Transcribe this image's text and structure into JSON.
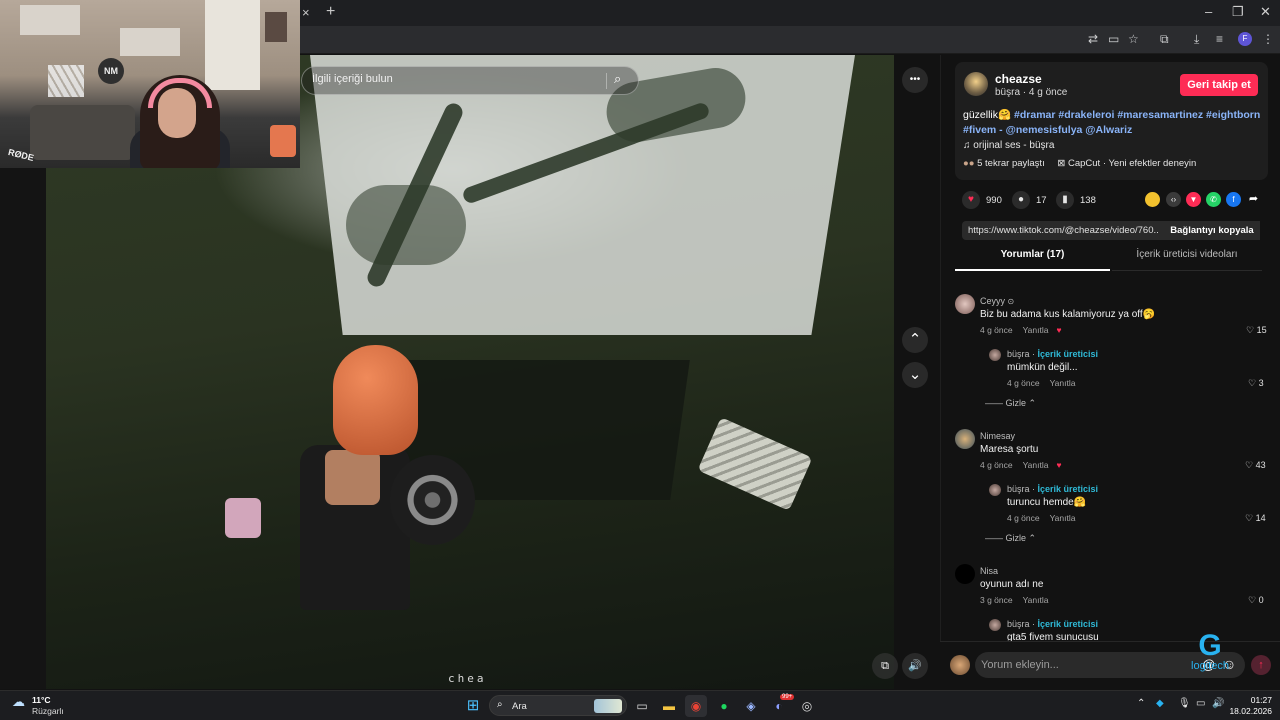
{
  "browser": {
    "tab_close_glyph": "×",
    "new_tab_glyph": "+",
    "window_controls": [
      "–",
      "❐",
      "✕"
    ],
    "toolbar_icons": [
      "translate-icon",
      "cast-icon",
      "star-icon",
      "extensions-icon",
      "download-icon",
      "media-icon"
    ],
    "profile_initial": "F",
    "menu_glyph": "⋮"
  },
  "video": {
    "search_placeholder": "İlgili içeriği bulun",
    "more_glyph": "•••",
    "up_glyph": "⌃",
    "down_glyph": "⌄",
    "watermark": "chea",
    "mute_glyph": "🔊",
    "pip_glyph": "⧉"
  },
  "webcam": {
    "logo": "NM",
    "mic_brand": "RØDE"
  },
  "author": {
    "username": "cheazse",
    "subtitle": "büşra · 4 g önce",
    "follow_label": "Geri takip et",
    "caption_text": "güzellik🤗",
    "caption_tags": "#dramar #drakeleroi #maresamartinez #eightborn #fivem - @nemesisfulya @Alwariz",
    "music": "orijinal ses - büşra",
    "reposts": "5 tekrar paylaştı",
    "capcut": "CapCut · Yeni efektler deneyin"
  },
  "stats": {
    "likes": "990",
    "comments": "17",
    "saves": "138"
  },
  "share_colors": [
    "#f2c12e",
    "#3a3a3a",
    "#fe2c55",
    "#25d366",
    "#1877f2",
    "#121212"
  ],
  "link": {
    "url": "https://www.tiktok.com/@cheazse/video/760...",
    "copy_label": "Bağlantıyı kopyala"
  },
  "tabs": {
    "comments": "Yorumlar (17)",
    "creator_videos": "İçerik üreticisi videoları"
  },
  "comments": [
    {
      "user": "Ceyyy",
      "text": "Biz bu adama kus kalamiyoruz ya off🥱",
      "time": "4 g önce",
      "reply_label": "Yanıtla",
      "likes": "15",
      "reply": {
        "user": "büşra",
        "creator_label": "İçerik üreticisi",
        "text": "mümkün değil...",
        "time": "4 g önce",
        "reply_label": "Yanıtla",
        "likes": "3"
      },
      "hide_label": "Gizle"
    },
    {
      "user": "Nimesay",
      "text": "Maresa şortu",
      "time": "4 g önce",
      "reply_label": "Yanıtla",
      "likes": "43",
      "reply": {
        "user": "büşra",
        "creator_label": "İçerik üreticisi",
        "text": "turuncu hemde🤗",
        "time": "4 g önce",
        "reply_label": "Yanıtla",
        "likes": "14"
      },
      "hide_label": "Gizle"
    },
    {
      "user": "Nisa",
      "text": "oyunun adı ne",
      "time": "3 g önce",
      "reply_label": "Yanıtla",
      "likes": "0",
      "reply": {
        "user": "büşra",
        "creator_label": "İçerik üreticisi",
        "text": "gta5 fivem sunucusu"
      }
    }
  ],
  "comment_input": {
    "placeholder": "Yorum ekleyin..."
  },
  "overlay_logo": {
    "glyph": "G",
    "text": "logitech"
  },
  "taskbar": {
    "temp": "11°C",
    "condition": "Rüzgarlı",
    "search_label": "Ara",
    "time": "01:27",
    "date": "18.02.2026",
    "discord_badge": "99+"
  }
}
